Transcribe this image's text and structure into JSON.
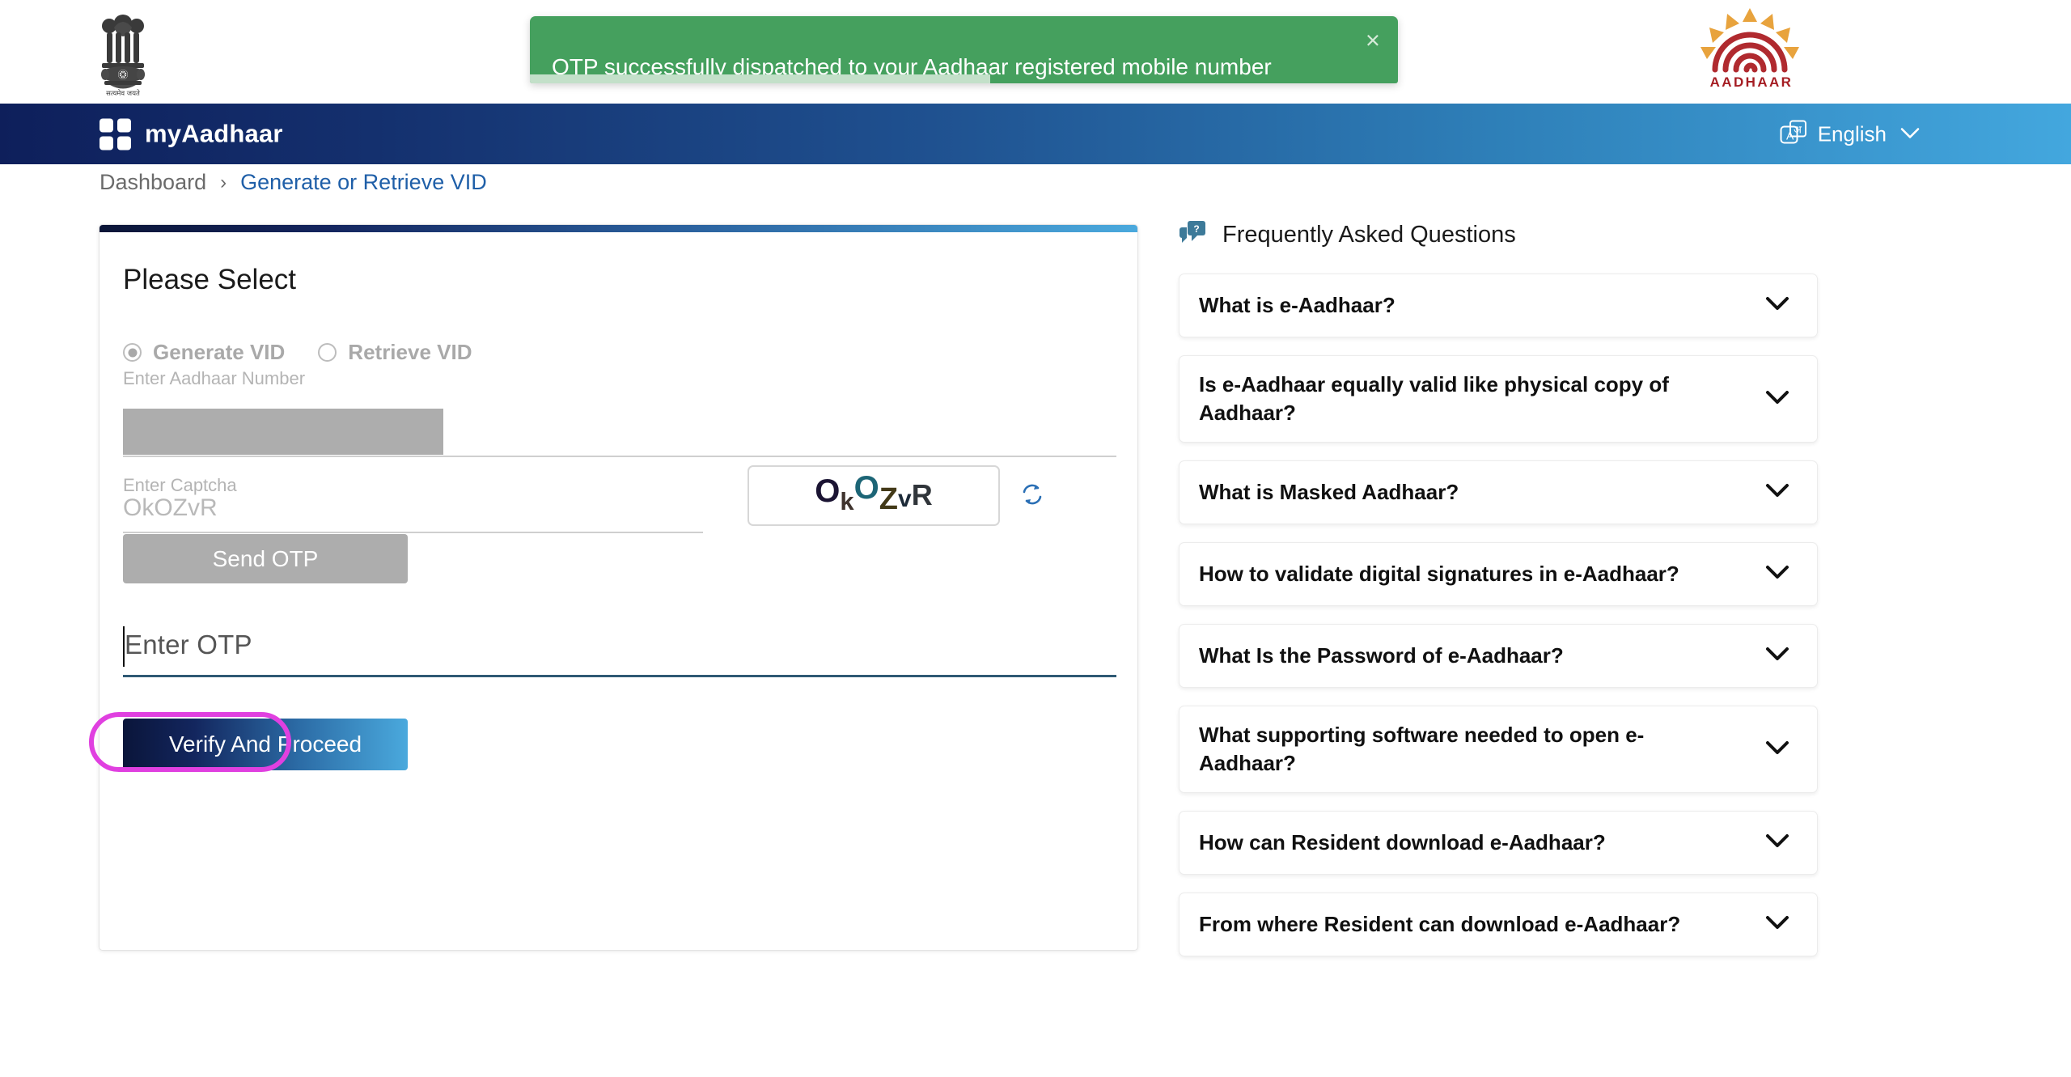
{
  "header": {
    "emblem_name": "india-national-emblem",
    "emblem_motto": "सत्यमेव जयते",
    "aadhaar_logo_text": "AADHAAR",
    "brand": "myAadhaar",
    "language": {
      "label": "English",
      "icon": "translate-icon",
      "caret": "⌄"
    }
  },
  "toast": {
    "message": "OTP successfully dispatched to your Aadhaar registered mobile number",
    "close_label": "×",
    "background": "#45a05e",
    "progress_percent": 53,
    "progress_color": "#c3e0c9"
  },
  "breadcrumb": {
    "root": "Dashboard",
    "separator": "›",
    "current": "Generate or Retrieve VID"
  },
  "form": {
    "title": "Please Select",
    "options": [
      {
        "label": "Generate VID",
        "selected": true
      },
      {
        "label": "Retrieve VID",
        "selected": false
      }
    ],
    "aadhaar": {
      "label": "Enter Aadhaar Number",
      "value": "",
      "redacted": true
    },
    "captcha": {
      "label": "Enter Captcha",
      "value": "OkOZvR",
      "image_text": "OkOZvR",
      "refresh_icon": "refresh-icon"
    },
    "send_otp_label": "Send OTP",
    "otp": {
      "placeholder": "Enter OTP",
      "value": "",
      "focused": true,
      "highlight_color": "#e040e0"
    },
    "verify_label": "Verify And Proceed"
  },
  "faq": {
    "icon": "question-bubble-icon",
    "title": "Frequently Asked Questions",
    "caret_icon": "chevron-down-icon",
    "items": [
      {
        "question": "What is e-Aadhaar?"
      },
      {
        "question": "Is e-Aadhaar equally valid like physical copy of Aadhaar?"
      },
      {
        "question": "What is Masked Aadhaar?"
      },
      {
        "question": "How to validate digital signatures in e-Aadhaar?"
      },
      {
        "question": "What Is the Password of e-Aadhaar?"
      },
      {
        "question": "What supporting software needed to open e-Aadhaar?"
      },
      {
        "question": "How can Resident download e-Aadhaar?"
      },
      {
        "question": "From where Resident can download e-Aadhaar?"
      }
    ]
  },
  "colors": {
    "navy": "#0e1f5b",
    "light_blue": "#43a7de",
    "link_blue": "#1f5fa8",
    "toast_green": "#45a05e",
    "magenta": "#e040e0"
  }
}
